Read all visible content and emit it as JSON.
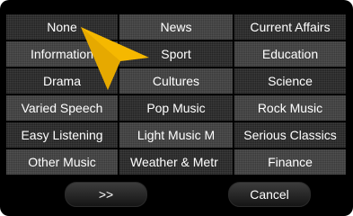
{
  "genres": [
    [
      "None",
      "News",
      "Current Affairs"
    ],
    [
      "Information",
      "Sport",
      "Education"
    ],
    [
      "Drama",
      "Cultures",
      "Science"
    ],
    [
      "Varied Speech",
      "Pop Music",
      "Rock Music"
    ],
    [
      "Easy Listening",
      "Light Music M",
      "Serious Classics"
    ],
    [
      "Other Music",
      "Weather & Metr",
      "Finance"
    ]
  ],
  "buttons": {
    "next": ">>",
    "cancel": "Cancel"
  },
  "icons": {
    "pointer": "arrow-pointer-icon"
  },
  "colors": {
    "pointer": "#F5B800",
    "cell_light": "#3a3a3a",
    "cell_dark": "#232323"
  }
}
